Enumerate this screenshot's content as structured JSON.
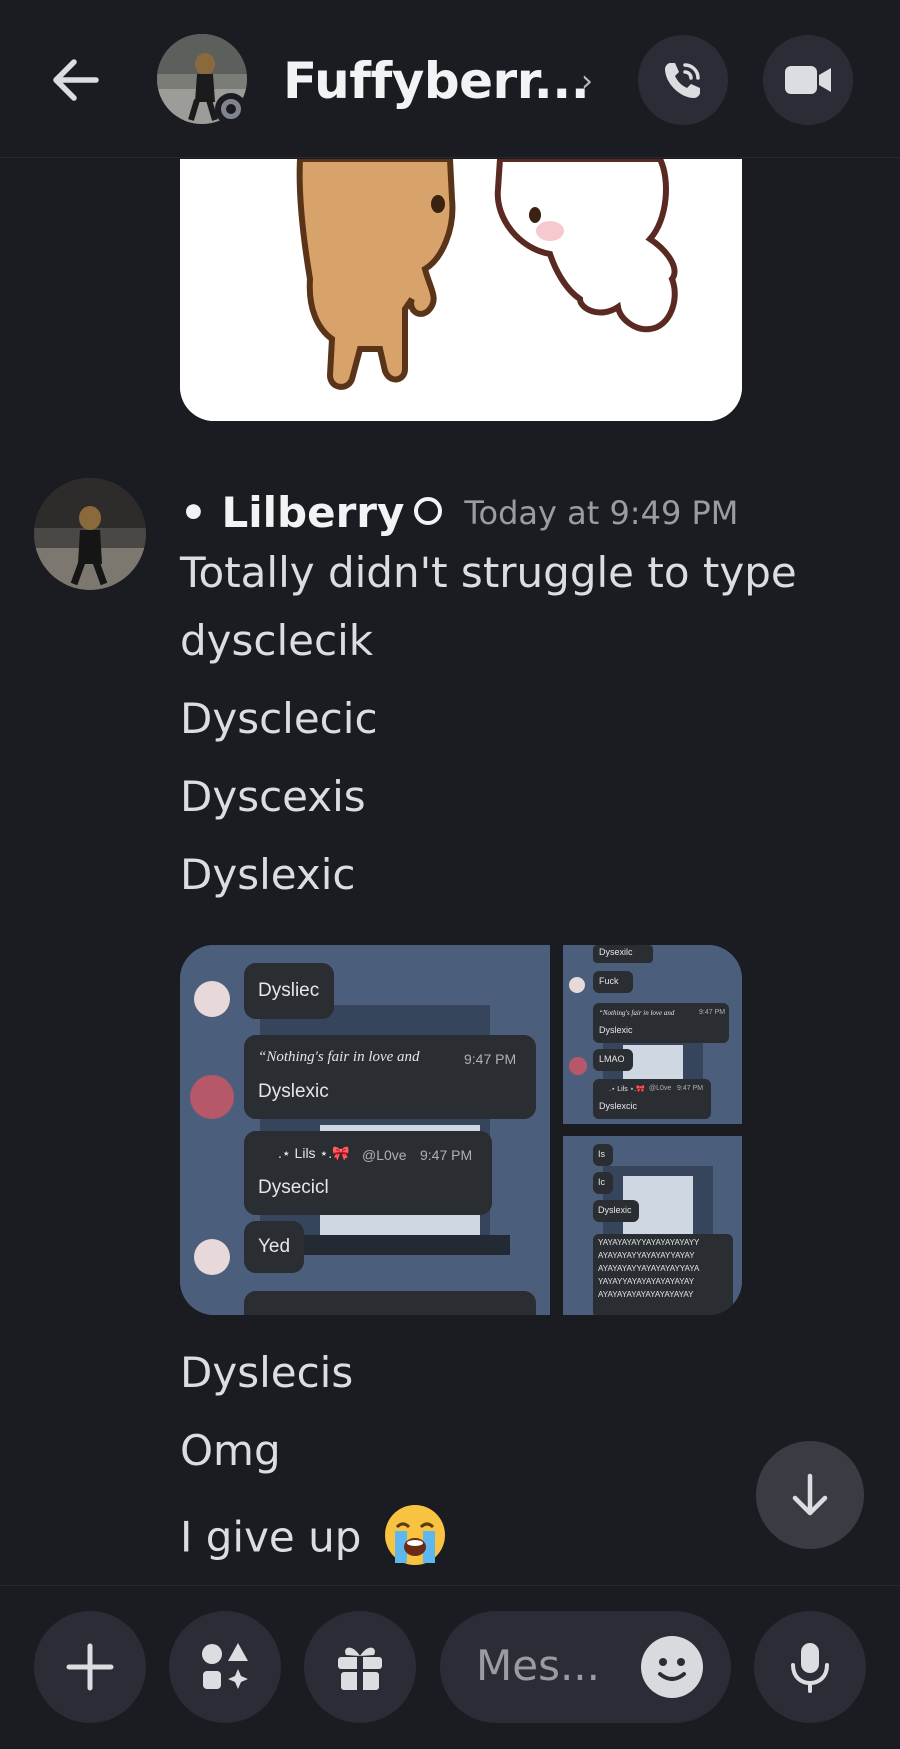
{
  "header": {
    "contact_name": "Fuffyberr...",
    "chevron": "›",
    "back_icon": "arrow-left-icon",
    "call_icon": "phone-call-icon",
    "video_icon": "video-camera-icon"
  },
  "message": {
    "author": "• Lilberry",
    "timestamp": "Today at 9:49 PM",
    "lines_top": [
      "Totally didn't struggle to type",
      "dysclecik",
      "Dysclecic",
      "Dyscexis",
      "Dyslexic"
    ],
    "lines_bottom": [
      "Dyslecis",
      "Omg",
      "I give up"
    ],
    "emoji": "😭"
  },
  "attachment_main": {
    "b1": "Dysliec",
    "b2_title": "“Nothing's fair in love and",
    "b2_time": "9:47 PM",
    "b2_text": "Dyslexic",
    "b3_name": ".⋆ Lils ⋆.🎀",
    "b3_handle": "@L0ve",
    "b3_time": "9:47 PM",
    "b3_text": "Dysecicl",
    "b4": "Yed"
  },
  "attachment_tr": {
    "t1": "Dysexilc",
    "t2": "Fuck",
    "t3_title": "“Nothing's fair in love and",
    "t3_time": "9:47 PM",
    "t3_text": "Dyslexic",
    "t4": "LMAO",
    "t5_name": ".⋆ Lils ⋆.🎀",
    "t5_handle": "@L0ve",
    "t5_time": "9:47 PM",
    "t5_text": "Dyslexcic"
  },
  "attachment_br": {
    "r1": "Is",
    "r2": "Ic",
    "r3": "Dyslexic",
    "r4_lines": [
      "YAYAYAYAYYAYAYAYAYAYY",
      "AYAYAYAYYAYAYAYYAYAY",
      "AYAYAYAYYAYAYAYAYYAYA",
      "YAYAYYAYAYAYAYAYAYAY",
      "AYAYAYAYAYAYAYAYAYAY"
    ]
  },
  "composer": {
    "placeholder": "Mes...",
    "plus_icon": "plus-icon",
    "apps_icon": "apps-icon",
    "gift_icon": "gift-icon",
    "emoji_icon": "emoji-icon",
    "mic_icon": "microphone-icon"
  },
  "colors": {
    "background": "#1a1c22",
    "button_bg": "#2b2d36",
    "text": "#dcdde1",
    "muted": "#9a9ca3"
  }
}
